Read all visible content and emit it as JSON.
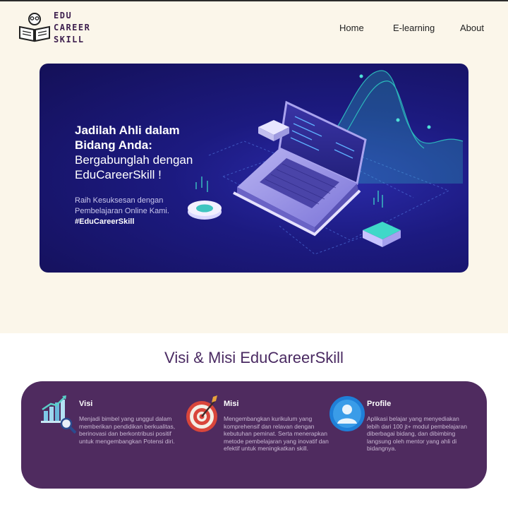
{
  "brand": {
    "line1": "EDU",
    "line2": "CAREER",
    "line3": "SKILL"
  },
  "nav": {
    "home": "Home",
    "elearning": "E-learning",
    "about": "About"
  },
  "hero": {
    "title_bold1": "Jadilah Ahli dalam",
    "title_bold2": "Bidang Anda:",
    "title_normal1": "Bergabunglah dengan",
    "title_normal2": "EduCareerSkill !",
    "sub1": "Raih Kesuksesan dengan",
    "sub2": "Pembelajaran Online Kami.",
    "tag": "#EduCareerSkill"
  },
  "section": {
    "title": "Visi & Misi EduCareerSkill"
  },
  "features": [
    {
      "title": "Visi",
      "icon": "growth-chart-icon",
      "desc": "Menjadi bimbel yang unggul dalam memberikan pendidikan berkualitas, berinovasi dan berkontribusi positif untuk mengembangkan Potensi diri."
    },
    {
      "title": "Misi",
      "icon": "target-icon",
      "desc": "Mengembangkan kurikulum yang komprehensif dan relavan dengan kebutuhan peminat. Serta menerapkan metode pembelajaran yang inovatif dan efektif untuk meningkatkan skill."
    },
    {
      "title": "Profile",
      "icon": "user-profile-icon",
      "desc": "Aplikasi belajar yang menyediakan lebih dari 100 jt+ modul pembelajaran diberbagai bidang, dan dibimbing langsung oleh mentor yang ahli di bidangnya."
    }
  ],
  "colors": {
    "accent": "#4f2b5f",
    "hero_bg": "#1c1a80",
    "page_top": "#fbf6ea"
  }
}
